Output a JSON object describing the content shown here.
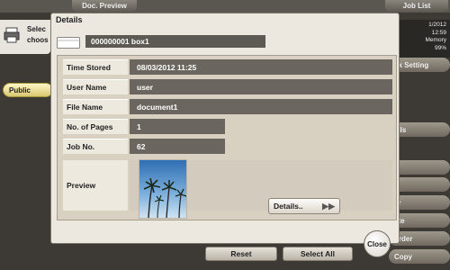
{
  "background": {
    "tabs": {
      "doc_preview": "Doc. Preview",
      "job_list": "Job List"
    },
    "info_line1": "Selec",
    "info_line2": "choos",
    "status": {
      "date": "1/2012",
      "time": "12:59",
      "memory_label": "Memory",
      "memory_value": "99%"
    },
    "public_button": "Public",
    "right_buttons": [
      "ck Setting",
      "ails",
      "t",
      "d",
      "er",
      "ete",
      "order",
      "Copy"
    ],
    "reset": "Reset",
    "select_all": "Select All"
  },
  "dialog": {
    "title": "Details",
    "box_name": "000000001  box1",
    "fields": {
      "time_stored": {
        "label": "Time Stored",
        "value": "08/03/2012  11:25"
      },
      "user_name": {
        "label": "User Name",
        "value": "user"
      },
      "file_name": {
        "label": "File Name",
        "value": "document1"
      },
      "pages": {
        "label": "No. of Pages",
        "value": "1"
      },
      "job_no": {
        "label": "Job No.",
        "value": "62"
      }
    },
    "preview_label": "Preview",
    "details_button": "Details..",
    "close_button": "Close"
  }
}
